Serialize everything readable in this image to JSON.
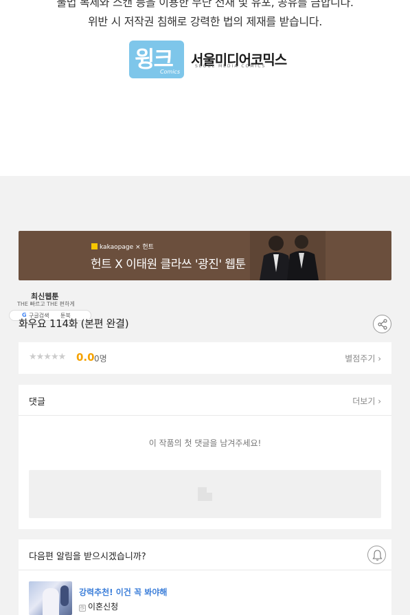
{
  "notice": {
    "line1": "불법 복제와 스캔 등을 이용한 무단 전재 및 유포, 공유를 금합니다.",
    "line2": "위반 시 저작권 침해로 강력한 법의 제재를 받습니다."
  },
  "publishers": {
    "wink_logo": "윙크",
    "wink_sub": "Comics",
    "seoul_logo": "서울미디어코믹스",
    "seoul_sub": "SEOUL MEDIA COMICS"
  },
  "banner": {
    "brand": "kakaopage × 헌트",
    "title": "헌트 X 이태원 클라쓰 '광진' 웹툰",
    "bg_color": "#6b4f3d"
  },
  "watermark": {
    "title": "최신웹툰",
    "sub": "THE 빠르고 THE 편하게",
    "search": "구글검색",
    "brand": "툰북"
  },
  "episode": {
    "title": "화우요 114화 (본편 완결)",
    "share_icon": "share-icon"
  },
  "rating": {
    "stars": "★★★★★",
    "score": "0.0",
    "count": "0명",
    "rate_label": "별점주기 ›"
  },
  "comments": {
    "title": "댓글",
    "more_label": "더보기 ›",
    "empty_text": "이 작품의 첫 댓글을 남겨주세요!"
  },
  "alert": {
    "title": "다음편 알림을 받으시겠습니까?",
    "bell_icon": "bell-icon"
  },
  "recommendation": {
    "title": "강력추천! 이건 꼭 봐야해",
    "author_badge": "作",
    "author": "이혼신청"
  },
  "colors": {
    "accent_orange": "#f5a200",
    "link_blue": "#3b7ed9",
    "wink_blue": "#7ec6ea"
  }
}
